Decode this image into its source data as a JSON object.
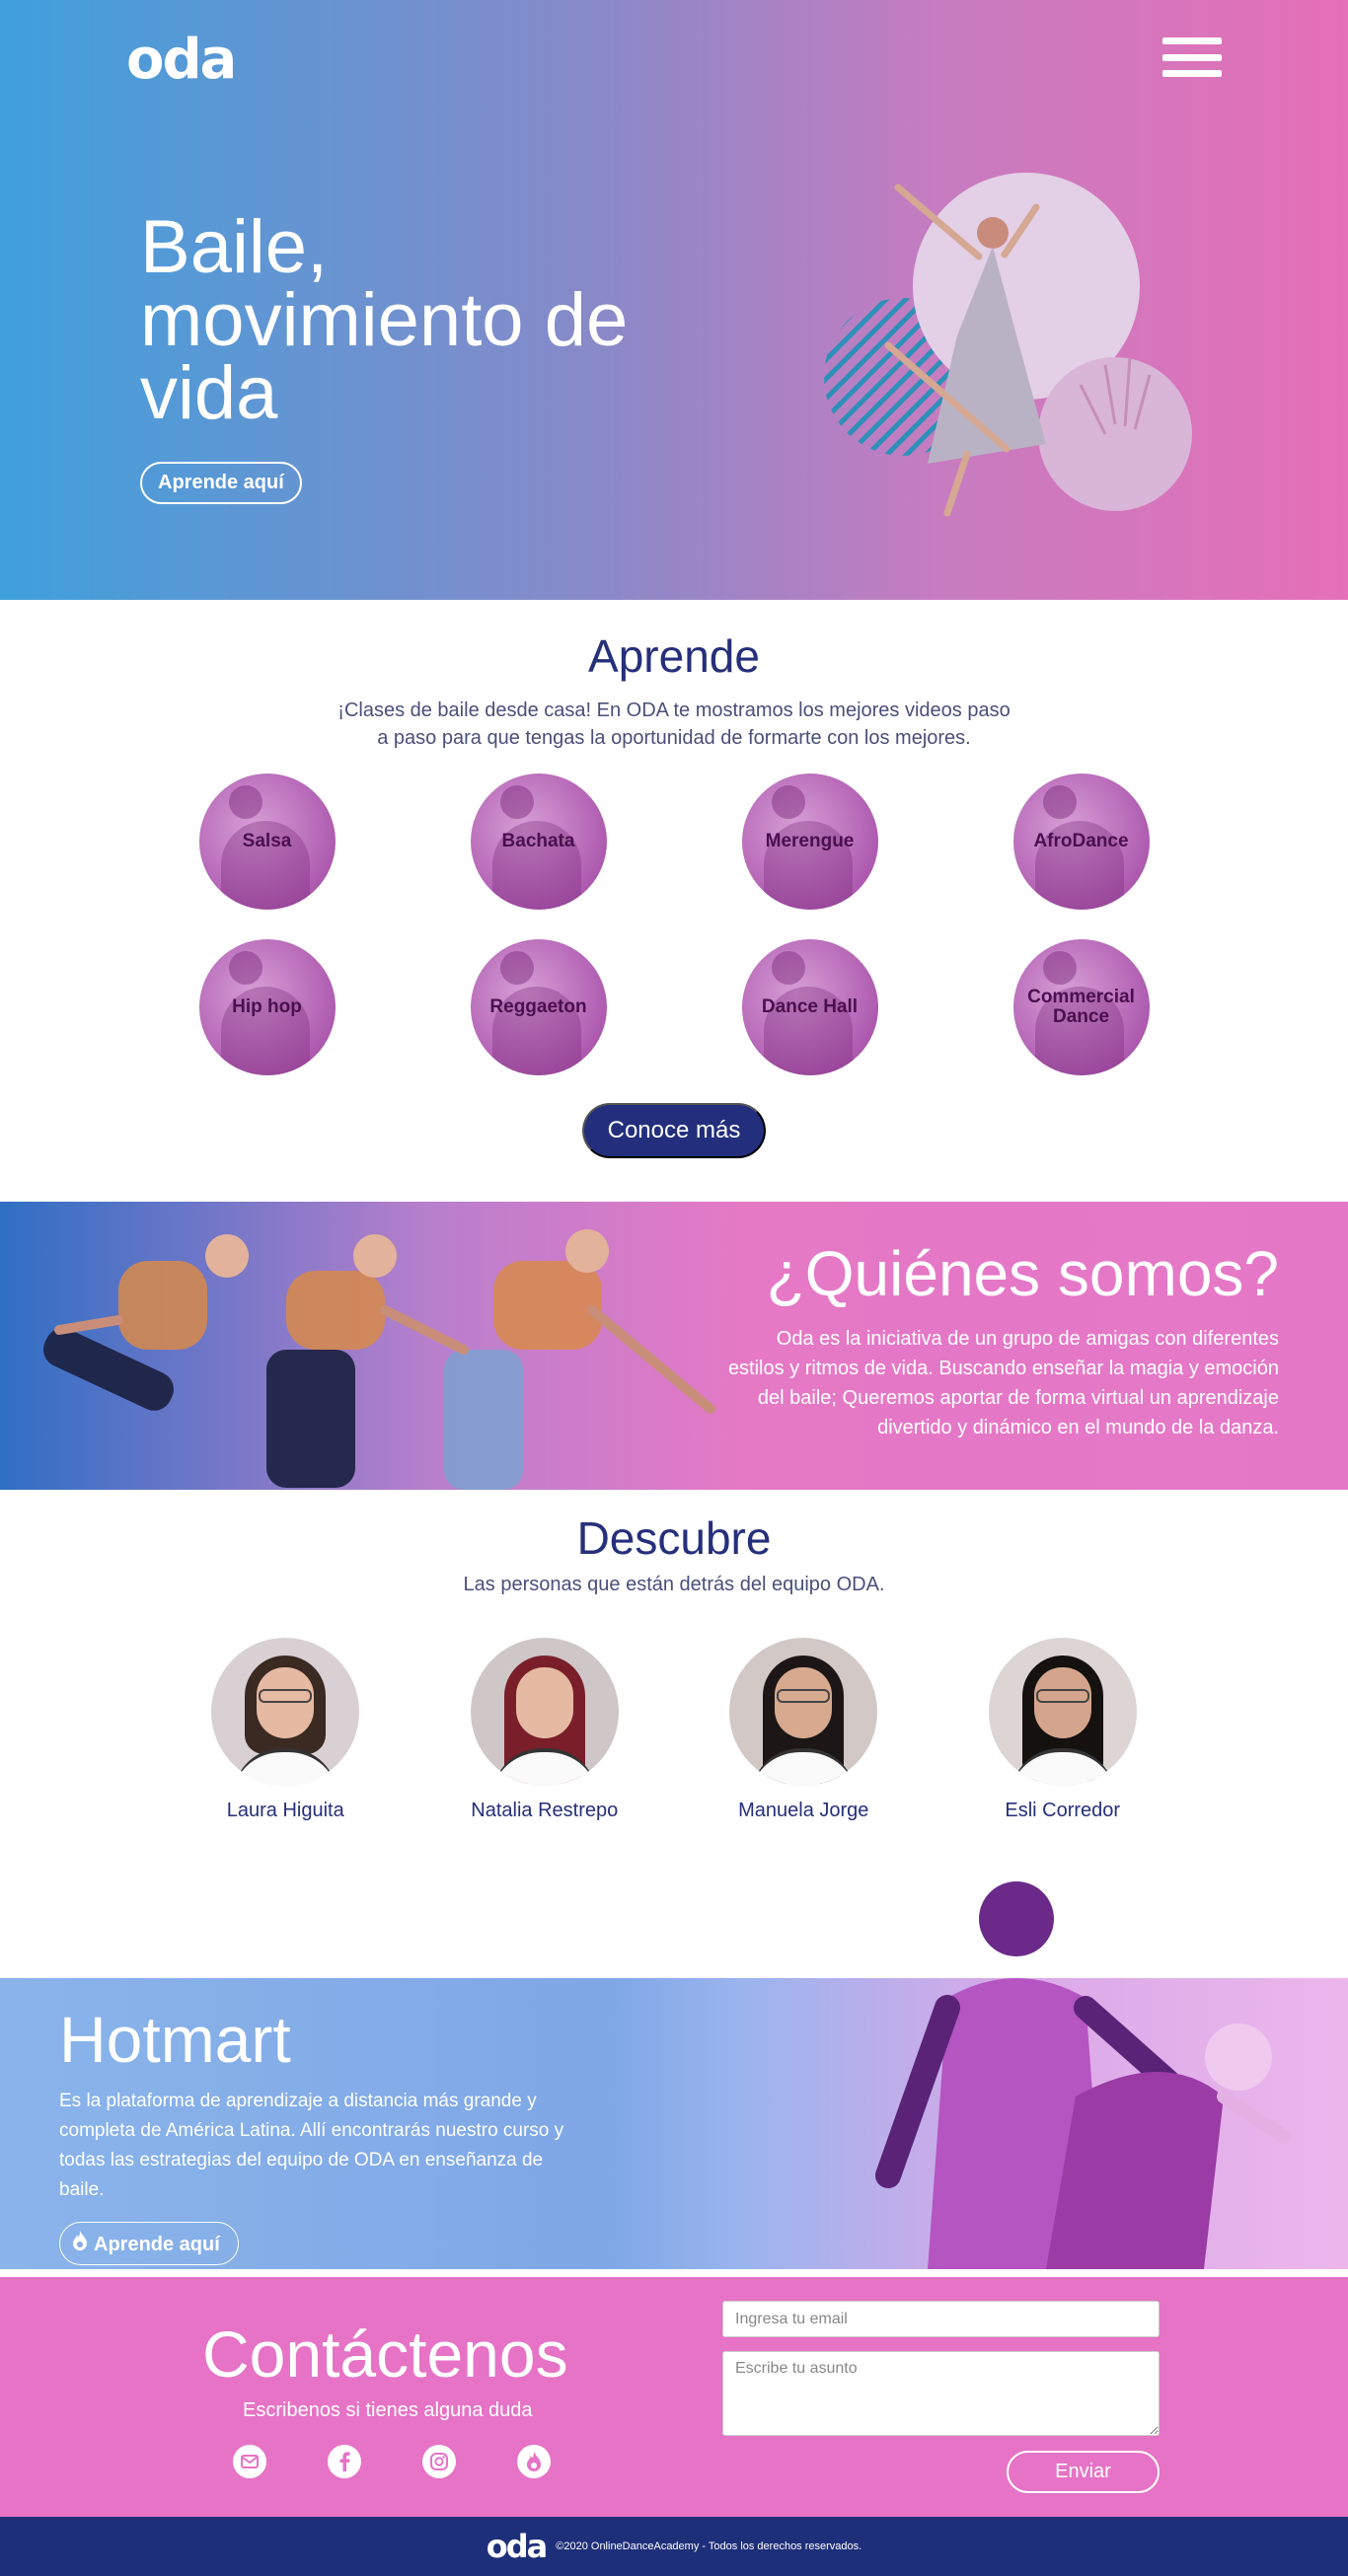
{
  "brand": {
    "logo_text": "oda"
  },
  "hero": {
    "title": "Baile, movimiento de vida",
    "cta": "Aprende aquí"
  },
  "aprende": {
    "title": "Aprende",
    "description_line1": "¡Clases de baile desde casa! En ODA te mostramos los mejores videos paso",
    "description_line2": "a paso para que tengas la oportunidad de formarte con los mejores.",
    "styles": [
      "Salsa",
      "Bachata",
      "Merengue",
      "AfroDance",
      "Hip hop",
      "Reggaeton",
      "Dance Hall",
      "Commercial Dance"
    ],
    "cta": "Conoce más"
  },
  "quienes": {
    "title": "¿Quiénes somos?",
    "text": "Oda es la iniciativa de un grupo de amigas con diferentes estilos y ritmos de vida. Buscando enseñar la magia y emoción del baile; Queremos aportar de forma virtual un aprendizaje divertido y dinámico en el mundo de la danza."
  },
  "descubre": {
    "title": "Descubre",
    "subtitle": "Las personas que están detrás del equipo ODA.",
    "team": [
      "Laura Higuita",
      "Natalia Restrepo",
      "Manuela Jorge",
      "Esli Corredor"
    ]
  },
  "hotmart": {
    "title": "Hotmart",
    "text": "Es la plataforma de aprendizaje a distancia más grande y completa de América Latina. Allí encontrarás nuestro curso y todas las estrategias del equipo de ODA en enseñanza de baile.",
    "cta": "Aprende aquí"
  },
  "contact": {
    "title": "Contáctenos",
    "subtitle": "Escribenos si tienes alguna duda",
    "email_placeholder": "Ingresa tu email",
    "subject_placeholder": "Escribe tu asunto",
    "submit": "Enviar",
    "socials": [
      "mail-icon",
      "facebook-icon",
      "instagram-icon",
      "hotmart-icon"
    ]
  },
  "footer": {
    "text": "©2020 OnlineDanceAcademy - Todos los derechos reservados."
  },
  "colors": {
    "navy": "#232f7c",
    "pink": "#e673c6",
    "blue": "#3fa0dc"
  }
}
